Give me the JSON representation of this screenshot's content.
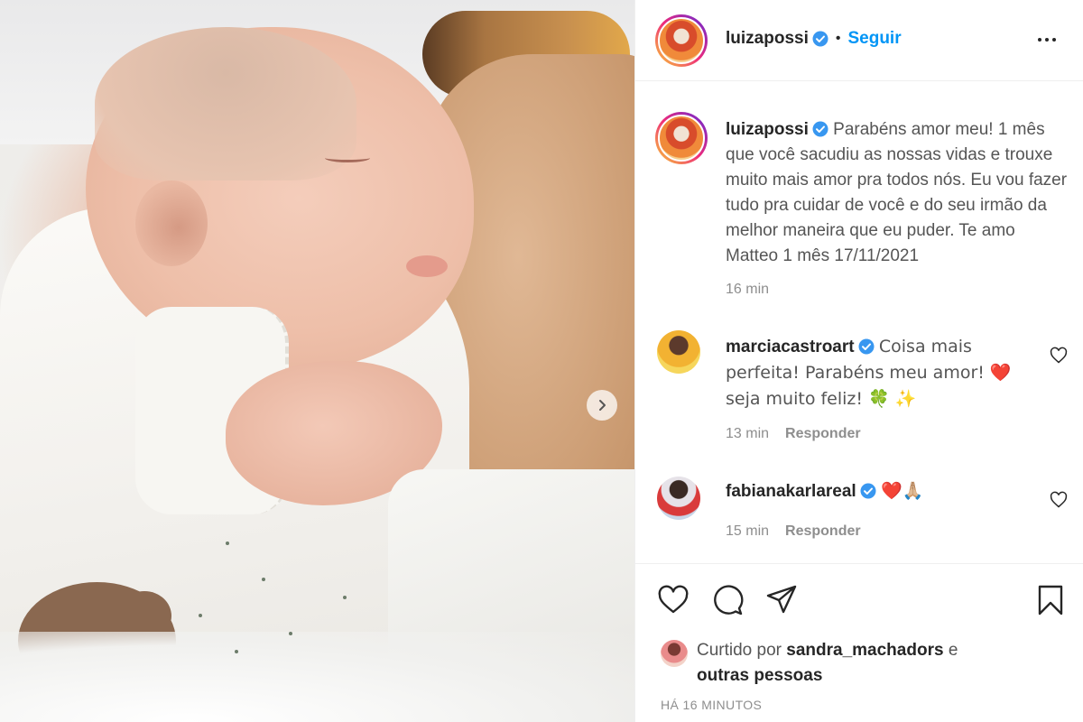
{
  "post": {
    "username": "luizapossi",
    "separator": "•",
    "follow_label": "Seguir",
    "caption": "Parabéns amor meu! 1 mês que você sacudiu as nossas vidas e trouxe muito mais amor pra todos nós. Eu vou fazer tudo pra cuidar de você e do seu irmão da melhor maneira que eu puder. Te amo Matteo 1 mês 17/11/2021",
    "caption_time": "16 min"
  },
  "comments": [
    {
      "username": "marciacastroart",
      "text": "Coisa mais perfeita! Parabéns meu amor! ❤️ seja muito feliz! 🍀 ✨",
      "time": "13 min",
      "reply_label": "Responder"
    },
    {
      "username": "fabianakarlareal",
      "text": "❤️🙏🏼",
      "time": "15 min",
      "reply_label": "Responder"
    }
  ],
  "likes": {
    "prefix": "Curtido por",
    "user": "sandra_machadors",
    "conjunction": "e",
    "others": "outras pessoas"
  },
  "post_date": "HÁ 16 MINUTOS",
  "icons": {
    "verified": "verified-badge-icon",
    "more": "more-options-icon",
    "next": "chevron-right-icon",
    "like": "heart-icon",
    "comment": "comment-icon",
    "share": "paper-plane-icon",
    "save": "bookmark-icon"
  },
  "colors": {
    "link_blue": "#0095f6",
    "verified_blue": "#3897f0",
    "text_primary": "#262626",
    "text_secondary": "#8e8e8e"
  }
}
